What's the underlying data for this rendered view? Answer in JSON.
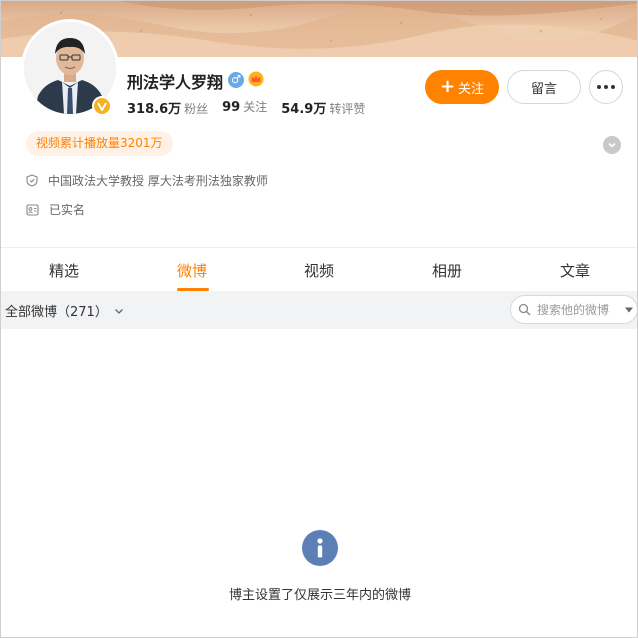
{
  "profile": {
    "name": "刑法学人罗翔",
    "gender_symbol": "♂",
    "stats": [
      {
        "value": "318.6万",
        "label": "粉丝"
      },
      {
        "value": "99",
        "label": "关注"
      },
      {
        "value": "54.9万",
        "label": "转评赞"
      }
    ],
    "video_play_count": "视频累计播放量3201万",
    "description": "中国政法大学教授 厚大法考刑法独家教师",
    "verification": "已实名",
    "badge_color": "#f5b323"
  },
  "actions": {
    "follow_label": "关注",
    "message_label": "留言"
  },
  "tabs": [
    {
      "label": "精选",
      "active": false
    },
    {
      "label": "微博",
      "active": true
    },
    {
      "label": "视频",
      "active": false
    },
    {
      "label": "相册",
      "active": false
    },
    {
      "label": "文章",
      "active": false
    }
  ],
  "filter": {
    "label": "全部微博（271）"
  },
  "search": {
    "placeholder": "搜索他的微博"
  },
  "empty_state": {
    "message": "博主设置了仅展示三年内的微博"
  },
  "colors": {
    "accent": "#ff8200",
    "info_icon": "#5c80b6"
  }
}
